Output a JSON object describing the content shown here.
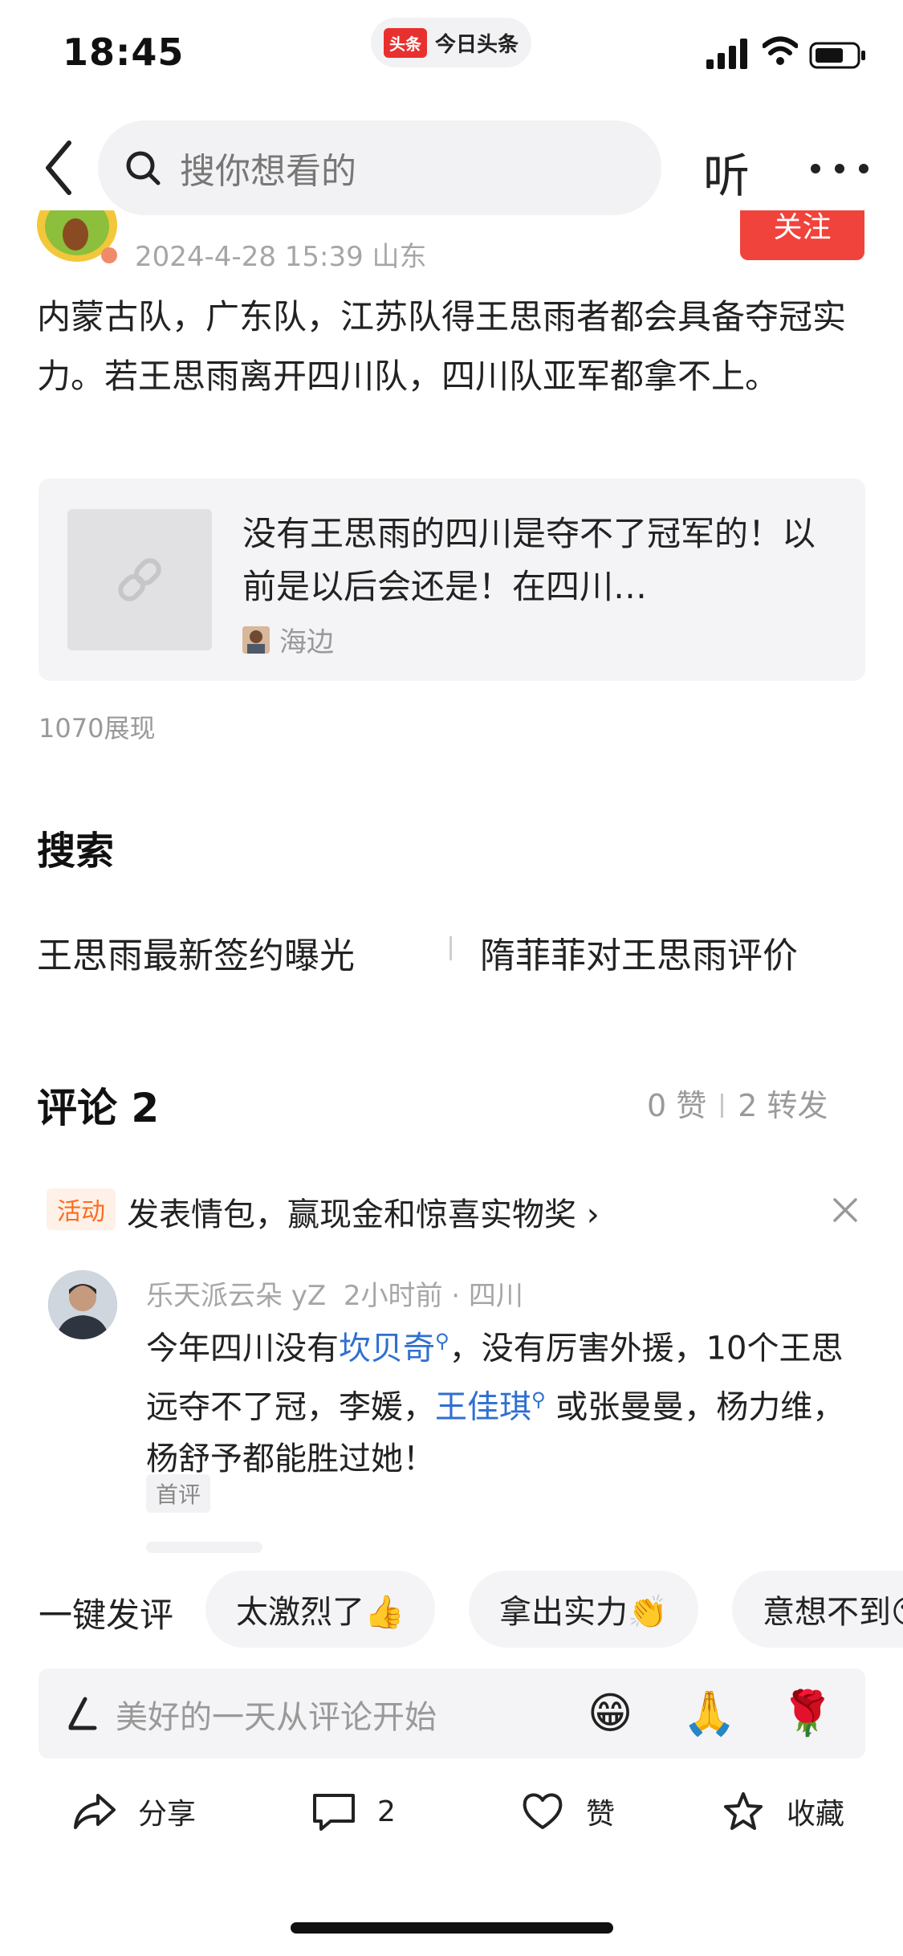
{
  "status_bar": {
    "time": "18:45",
    "app_logo": "头条",
    "app_name": "今日头条"
  },
  "header": {
    "search_placeholder": "搜你想看的",
    "listen_label": "听",
    "icons": [
      "back-icon",
      "search-icon",
      "more-icon"
    ]
  },
  "post": {
    "meta": "2024-4-28 15:39  山东",
    "follow_label": "关注",
    "text": "内蒙古队，广东队，江苏队得王思雨者都会具备夺冠实力。若王思雨离开四川队，四川队亚军都拿不上。",
    "link_card": {
      "title": "没有王思雨的四川是夺不了冠军的！以前是以后会还是！在四川…",
      "author": "海边"
    },
    "views": "1070展现"
  },
  "search_section": {
    "title": "搜索",
    "suggestions": [
      "王思雨最新签约曝光",
      "隋菲菲对王思雨评价"
    ]
  },
  "comments": {
    "title": "评论 2",
    "likes": "0 赞",
    "shares": "2 转发",
    "activity": {
      "badge": "活动",
      "text": "发表情包，赢现金和惊喜实物奖 ›"
    },
    "items": [
      {
        "name": "乐天派云朵 yZ",
        "meta": "2小时前 · 四川",
        "text_parts": [
          "今年四川没有",
          "坎贝奇",
          "，没有厉害外援，10个王思远夺不了冠，李媛，",
          "王佳琪",
          "或张曼曼，杨力维，杨舒予都能胜过她！"
        ],
        "badge": "首评"
      }
    ]
  },
  "quick_reply": {
    "label": "一键发评",
    "chips": [
      "太激烈了👍",
      "拿出实力👏",
      "意想不到😮"
    ]
  },
  "comment_input": {
    "placeholder": "美好的一天从评论开始",
    "emojis": [
      "😁",
      "🙏",
      "🌹"
    ]
  },
  "bottom_nav": {
    "share": "分享",
    "comments": "2",
    "like": "赞",
    "favorite": "收藏"
  }
}
